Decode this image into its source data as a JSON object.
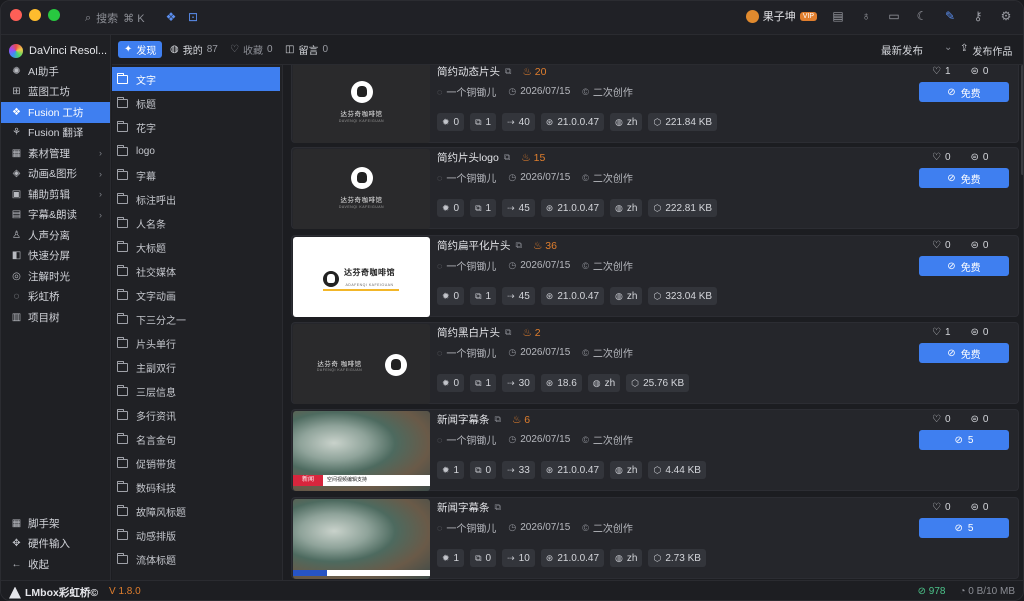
{
  "titlebar": {
    "search_label": "搜索",
    "search_shortcut": "⌘ K",
    "user_name": "果子坤",
    "vip_badge": "VIP"
  },
  "nav": {
    "brand": "DaVinci Resol...",
    "items": [
      {
        "label": "AI助手",
        "icon": "sparkle-icon"
      },
      {
        "label": "蓝图工坊",
        "icon": "blueprint-icon"
      },
      {
        "label": "Fusion 工坊",
        "icon": "fusion-icon",
        "active": true
      },
      {
        "label": "Fusion 翻译",
        "icon": "translate-icon"
      },
      {
        "label": "素材管理",
        "icon": "grid-icon",
        "chevron": true
      },
      {
        "label": "动画&图形",
        "icon": "shapes-icon",
        "chevron": true
      },
      {
        "label": "辅助剪辑",
        "icon": "clip-icon",
        "chevron": true
      },
      {
        "label": "字幕&朗读",
        "icon": "caption-icon",
        "chevron": true
      },
      {
        "label": "人声分离",
        "icon": "voice-icon"
      },
      {
        "label": "快速分屏",
        "icon": "split-icon"
      },
      {
        "label": "注解时光",
        "icon": "annotate-icon"
      },
      {
        "label": "彩虹桥",
        "icon": "rainbow-icon"
      },
      {
        "label": "项目树",
        "icon": "tree-icon"
      }
    ],
    "bottom_items": [
      {
        "label": "脚手架",
        "icon": "scaffold-icon"
      },
      {
        "label": "硬件输入",
        "icon": "hardware-icon"
      },
      {
        "label": "收起",
        "icon": "collapse-icon"
      }
    ]
  },
  "filterbar": {
    "tabs": [
      {
        "label": "发现",
        "count": ""
      },
      {
        "label": "我的",
        "count": "87"
      },
      {
        "label": "收藏",
        "count": "0"
      },
      {
        "label": "留言",
        "count": "0"
      }
    ],
    "sort_label": "最新发布",
    "publish_label": "发布作品"
  },
  "categories": [
    "文字",
    "标题",
    "花字",
    "logo",
    "字幕",
    "标注呼出",
    "人名条",
    "大标题",
    "社交媒体",
    "文字动画",
    "下三分之一",
    "片头单行",
    "主副双行",
    "三层信息",
    "多行资讯",
    "名言金句",
    "促销带货",
    "数码科技",
    "故障风标题",
    "动感排版",
    "流体标题"
  ],
  "cards": [
    {
      "title": "简约动态片头",
      "fire": "20",
      "author": "一个铜锄儿",
      "date": "2026/07/15",
      "license": "二次创作",
      "nodes": "0",
      "layers": "1",
      "uses": "40",
      "version": "21.0.0.47",
      "lang": "zh",
      "size": "221.84 KB",
      "likes": "1",
      "comments": "0",
      "action": "免费",
      "thumb_text": "达芬奇咖啡馆",
      "thumb_sub": "DAVENQI KAFEIGUAN"
    },
    {
      "title": "简约片头logo",
      "fire": "15",
      "author": "一个铜锄儿",
      "date": "2026/07/15",
      "license": "二次创作",
      "nodes": "0",
      "layers": "1",
      "uses": "45",
      "version": "21.0.0.47",
      "lang": "zh",
      "size": "222.81 KB",
      "likes": "0",
      "comments": "0",
      "action": "免费",
      "thumb_text": "达芬奇咖啡馆",
      "thumb_sub": "DAVENQI KAFEIGUAN"
    },
    {
      "title": "简约扁平化片头",
      "fire": "36",
      "author": "一个铜锄儿",
      "date": "2026/07/15",
      "license": "二次创作",
      "nodes": "0",
      "layers": "1",
      "uses": "45",
      "version": "21.0.0.47",
      "lang": "zh",
      "size": "323.04 KB",
      "likes": "0",
      "comments": "0",
      "action": "免费",
      "thumb_text": "达芬奇咖啡馆",
      "thumb_sub": "ADAFENQI KAFEIGUAN"
    },
    {
      "title": "简约黑白片头",
      "fire": "2",
      "author": "一个铜锄儿",
      "date": "2026/07/15",
      "license": "二次创作",
      "nodes": "0",
      "layers": "1",
      "uses": "30",
      "version": "18.6",
      "lang": "zh",
      "size": "25.76 KB",
      "likes": "1",
      "comments": "0",
      "action": "免费",
      "thumb_text": "达芬奇 咖啡馆",
      "thumb_sub": "DAFENQI KAFEIGUAN"
    },
    {
      "title": "新闻字幕条",
      "fire": "6",
      "author": "一个铜锄儿",
      "date": "2026/07/15",
      "license": "二次创作",
      "nodes": "1",
      "layers": "0",
      "uses": "33",
      "version": "21.0.0.47",
      "lang": "zh",
      "size": "4.44 KB",
      "likes": "0",
      "comments": "0",
      "action": "5",
      "thumb_text": "空间视频编辑支持",
      "thumb_sub": "新闻"
    },
    {
      "title": "新闻字幕条",
      "fire": "",
      "author": "一个铜锄儿",
      "date": "2026/07/15",
      "license": "二次创作",
      "nodes": "1",
      "layers": "0",
      "uses": "10",
      "version": "21.0.0.47",
      "lang": "zh",
      "size": "2.73 KB",
      "likes": "0",
      "comments": "0",
      "action": "5",
      "thumb_text": "",
      "thumb_sub": ""
    }
  ],
  "statusbar": {
    "brand": "LMbox彩虹桥©",
    "version": "V 1.8.0",
    "count": "978",
    "network": "0 B/10 MB"
  },
  "colors": {
    "accent": "#3f7ff0",
    "fire": "#e07e2d",
    "ok": "#4cc38a"
  }
}
